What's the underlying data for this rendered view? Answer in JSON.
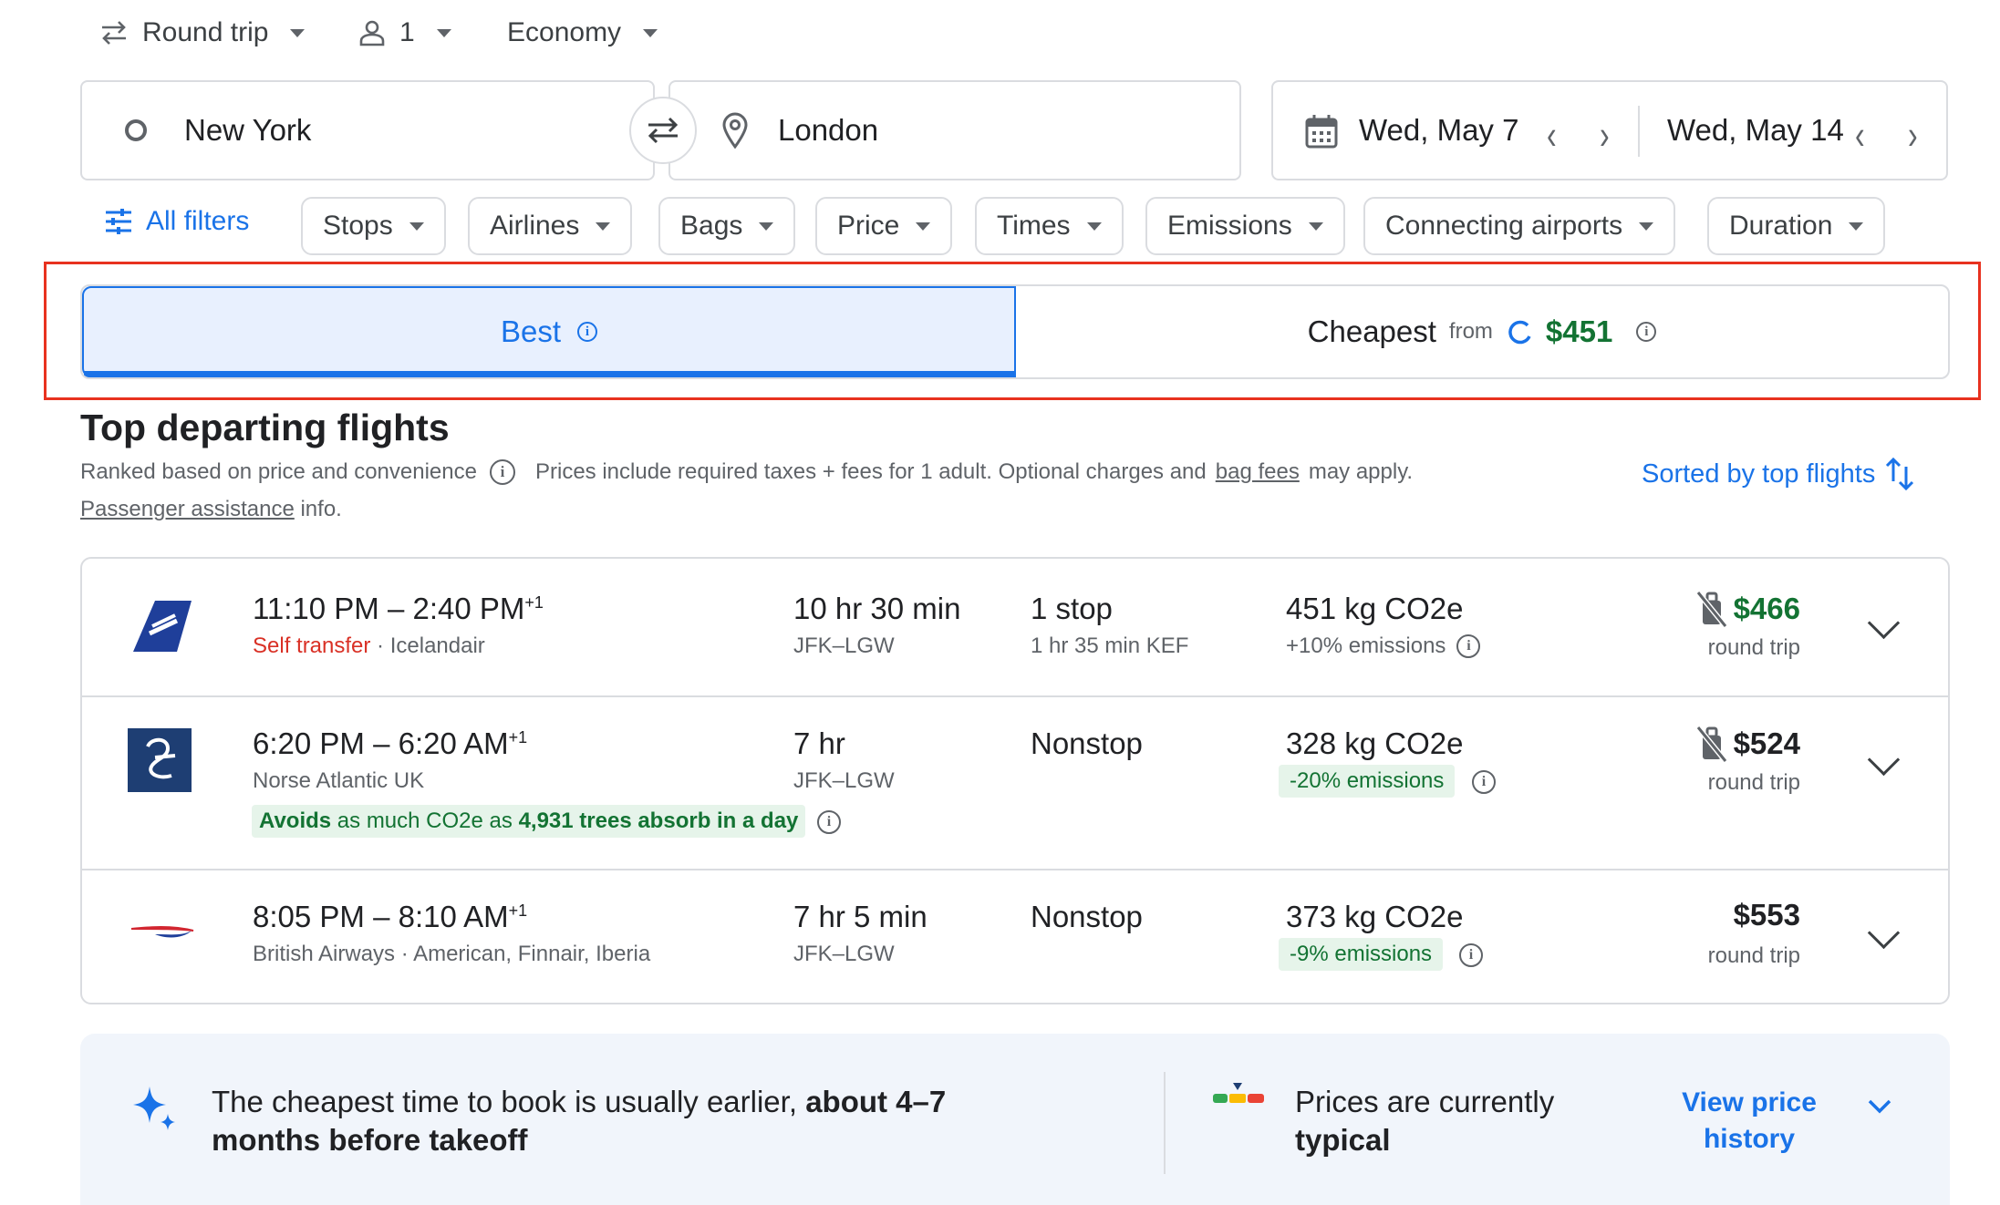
{
  "trip_options": {
    "trip_type": "Round trip",
    "passengers": "1",
    "cabin": "Economy"
  },
  "search": {
    "origin": "New York",
    "destination": "London",
    "depart_date": "Wed, May 7",
    "return_date": "Wed, May 14"
  },
  "filters": {
    "all_filters": "All filters",
    "chips": [
      "Stops",
      "Airlines",
      "Bags",
      "Price",
      "Times",
      "Emissions",
      "Connecting airports",
      "Duration"
    ]
  },
  "sort_tabs": {
    "best": "Best",
    "cheapest": "Cheapest",
    "cheapest_from": "from",
    "cheapest_price": "$451"
  },
  "section": {
    "title": "Top departing flights",
    "ranked": "Ranked based on price and convenience",
    "prices_note_pre": "Prices include required taxes + fees for 1 adult. Optional charges and",
    "bag_fees": "bag fees",
    "prices_note_post": "may apply.",
    "passenger_assistance": "Passenger assistance",
    "info": "info.",
    "sorted_by": "Sorted by top flights"
  },
  "flights": [
    {
      "times": "11:10 PM – 2:40 PM",
      "plus": "+1",
      "self_transfer": "Self transfer",
      "sep": " · ",
      "airline": "Icelandair",
      "duration": "10 hr 30 min",
      "route": "JFK–LGW",
      "stops": "1 stop",
      "layover": "1 hr 35 min KEF",
      "co2": "451 kg CO2e",
      "emissions": "+10% emissions",
      "price": "$466",
      "price_color": "#137333",
      "trip": "round trip"
    },
    {
      "times": "6:20 PM – 6:20 AM",
      "plus": "+1",
      "airline": "Norse Atlantic UK",
      "duration": "7 hr",
      "route": "JFK–LGW",
      "stops": "Nonstop",
      "co2": "328 kg CO2e",
      "emissions": "-20% emissions",
      "avoid_a": "Avoids",
      "avoid_b": "as much CO2e as",
      "avoid_c": "4,931 trees absorb in a day",
      "price": "$524",
      "price_color": "#202124",
      "trip": "round trip"
    },
    {
      "times": "8:05 PM – 8:10 AM",
      "plus": "+1",
      "airline": "British Airways",
      "sep": " · ",
      "partners": "American, Finnair, Iberia",
      "duration": "7 hr 5 min",
      "route": "JFK–LGW",
      "stops": "Nonstop",
      "co2": "373 kg CO2e",
      "emissions": "-9% emissions",
      "price": "$553",
      "price_color": "#202124",
      "trip": "round trip"
    }
  ],
  "insight": {
    "text_a": "The cheapest time to book is usually earlier,",
    "text_b": "about 4–7 months before takeoff",
    "typical_a": "Prices are currently",
    "typical_b": "typical",
    "view_history": "View price history"
  },
  "colors": {
    "accent": "#1a73e8",
    "green": "#137333",
    "highlight": "#e8321f",
    "red": "#d93025"
  }
}
